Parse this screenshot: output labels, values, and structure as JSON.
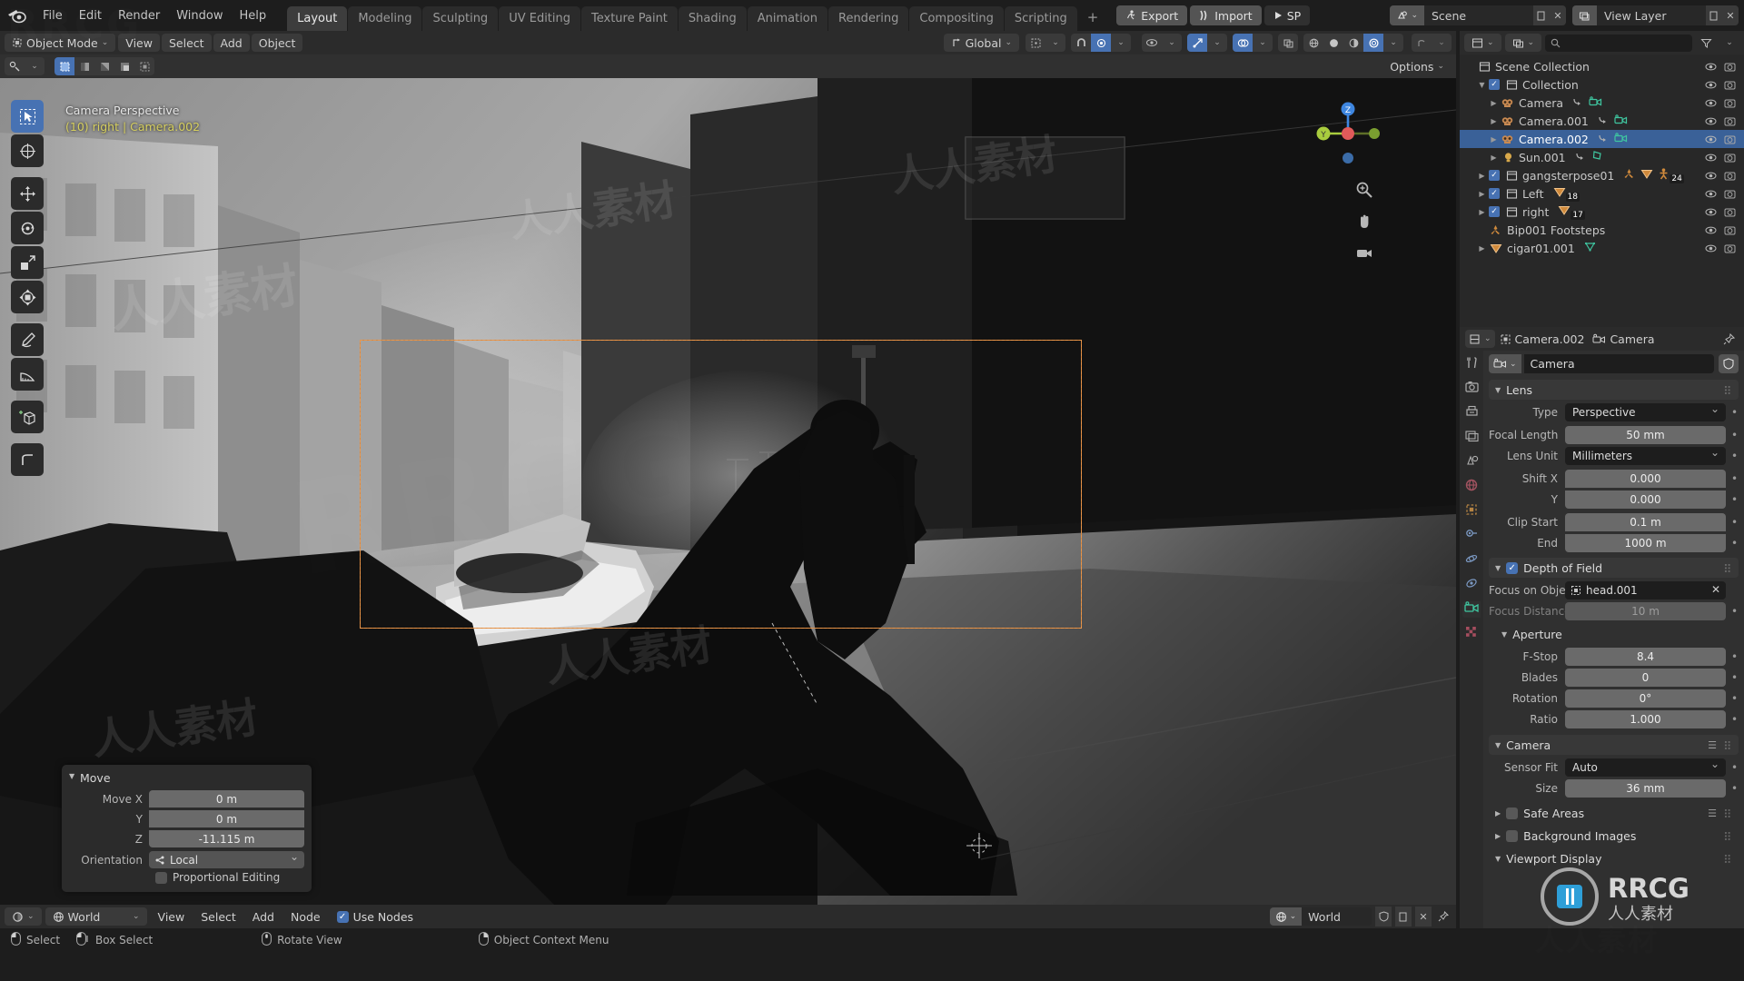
{
  "app": {
    "name": "Blender",
    "menus": [
      "File",
      "Edit",
      "Render",
      "Window",
      "Help"
    ],
    "workspace_tabs": [
      {
        "label": "Layout",
        "active": true
      },
      {
        "label": "Modeling",
        "active": false
      },
      {
        "label": "Sculpting",
        "active": false
      },
      {
        "label": "UV Editing",
        "active": false
      },
      {
        "label": "Texture Paint",
        "active": false
      },
      {
        "label": "Shading",
        "active": false
      },
      {
        "label": "Animation",
        "active": false
      },
      {
        "label": "Rendering",
        "active": false
      },
      {
        "label": "Compositing",
        "active": false
      },
      {
        "label": "Scripting",
        "active": false
      }
    ],
    "tab_add": "+",
    "addon_buttons": [
      {
        "label": "Export",
        "icon": "person-run-icon"
      },
      {
        "label": "Import",
        "icon": "import-arrow-icon"
      },
      {
        "label": "SP",
        "icon": "play-icon"
      }
    ],
    "scene_selector": {
      "icon": "scene-icon",
      "value": "Scene"
    },
    "viewlayer_selector": {
      "icon": "viewlayer-icon",
      "value": "View Layer"
    }
  },
  "viewport_header": {
    "mode": "Object Mode",
    "menus": [
      "View",
      "Select",
      "Add",
      "Object"
    ],
    "transform_orientation": "Global",
    "options_label": "Options",
    "snap_icon": "magnet-icon",
    "proportional_icon": "proportional-edit-icon",
    "shading_modes": [
      "wireframe",
      "solid",
      "material-preview",
      "rendered"
    ],
    "active_shading": "rendered"
  },
  "viewport": {
    "overlay_view": "Camera Perspective",
    "overlay_object": "(10) right | Camera.002",
    "tools": [
      {
        "name": "tweak-select-box-tool",
        "active": true
      },
      {
        "name": "cursor-tool",
        "active": false
      },
      {
        "name": "move-tool",
        "active": false
      },
      {
        "name": "rotate-tool",
        "active": false
      },
      {
        "name": "scale-tool",
        "active": false
      },
      {
        "name": "transform-tool",
        "active": false
      },
      {
        "name": "annotate-tool",
        "active": false
      },
      {
        "name": "measure-tool",
        "active": false
      },
      {
        "name": "add-cube-tool",
        "active": false
      },
      {
        "name": "extrude-tool",
        "active": false
      }
    ],
    "gizmo_axes": [
      "X",
      "Y",
      "Z"
    ],
    "nav_buttons": [
      "zoom-icon",
      "pan-hand-icon",
      "camera-view-icon"
    ]
  },
  "operator_panel": {
    "title": "Move",
    "rows": [
      {
        "label": "Move X",
        "value": "0 m"
      },
      {
        "label": "Y",
        "value": "0 m"
      },
      {
        "label": "Z",
        "value": "-11.115 m"
      }
    ],
    "orientation_label": "Orientation",
    "orientation_value": "Local",
    "proportional_label": "Proportional Editing",
    "proportional_checked": false
  },
  "shader_editor_header": {
    "editor_icon": "shader-editor-icon",
    "shader_type": "World",
    "menus": [
      "View",
      "Select",
      "Add",
      "Node"
    ],
    "use_nodes_label": "Use Nodes",
    "use_nodes_checked": true,
    "world_datablock": "World"
  },
  "status_bar": {
    "items": [
      {
        "icon": "mouse-left-icon",
        "label": "Select"
      },
      {
        "icon": "mouse-left-drag-icon",
        "label": "Box Select"
      },
      {
        "icon": "mouse-middle-icon",
        "label": "Rotate View"
      },
      {
        "icon": "mouse-right-icon",
        "label": "Object Context Menu"
      }
    ]
  },
  "outliner": {
    "display_mode": "View Layer",
    "filter_icon": "filter-icon",
    "search_icon": "search-icon",
    "root": "Scene Collection",
    "rows": [
      {
        "indent": 0,
        "label": "Scene Collection",
        "icon": "collection-icon",
        "disclosure": "",
        "checkbox": null,
        "selected": false,
        "badges": []
      },
      {
        "indent": 1,
        "label": "Collection",
        "icon": "collection-icon",
        "disclosure": "down",
        "checkbox": true,
        "selected": false,
        "badges": []
      },
      {
        "indent": 2,
        "label": "Camera",
        "icon": "camera-object-icon",
        "disclosure": "right",
        "checkbox": null,
        "selected": false,
        "badges": [
          "camera-data-icon"
        ]
      },
      {
        "indent": 2,
        "label": "Camera.001",
        "icon": "camera-object-icon",
        "disclosure": "right",
        "checkbox": null,
        "selected": false,
        "badges": [
          "camera-data-icon"
        ]
      },
      {
        "indent": 2,
        "label": "Camera.002",
        "icon": "camera-object-icon",
        "disclosure": "right",
        "checkbox": null,
        "selected": true,
        "badges": [
          "camera-data-icon"
        ]
      },
      {
        "indent": 2,
        "label": "Sun.001",
        "icon": "light-object-icon",
        "disclosure": "right",
        "checkbox": null,
        "selected": false,
        "badges": [
          "light-data-icon"
        ]
      },
      {
        "indent": 1,
        "label": "gangsterpose01",
        "icon": "collection-icon",
        "disclosure": "right",
        "checkbox": true,
        "selected": false,
        "badges": [
          "armature-icon",
          "mesh-icon",
          "pose-icon"
        ],
        "badge_count": "24"
      },
      {
        "indent": 1,
        "label": "Left",
        "icon": "collection-icon",
        "disclosure": "right",
        "checkbox": true,
        "selected": false,
        "badges": [
          "mesh-icon"
        ],
        "badge_count": "18"
      },
      {
        "indent": 1,
        "label": "right",
        "icon": "collection-icon",
        "disclosure": "right",
        "checkbox": true,
        "selected": false,
        "badges": [
          "mesh-icon"
        ],
        "badge_count": "17"
      },
      {
        "indent": 1,
        "label": "Bip001 Footsteps",
        "icon": "armature-icon",
        "disclosure": "",
        "checkbox": null,
        "selected": false,
        "badges": []
      },
      {
        "indent": 1,
        "label": "cigar01.001",
        "icon": "mesh-icon",
        "disclosure": "right",
        "checkbox": null,
        "selected": false,
        "badges": [
          "mesh-data-icon"
        ]
      }
    ]
  },
  "properties": {
    "breadcrumb": [
      {
        "label": "Camera.002",
        "icon": "object-icon"
      },
      {
        "label": "Camera",
        "icon": "camera-data-icon"
      }
    ],
    "pin_icon": "pin-icon",
    "datablock_name": "Camera",
    "tabs": [
      {
        "name": "tool-tab",
        "icon": "wrench-screwdriver-icon",
        "active": false
      },
      {
        "name": "render-tab",
        "icon": "camera-back-icon",
        "active": false
      },
      {
        "name": "output-tab",
        "icon": "printer-icon",
        "active": false
      },
      {
        "name": "viewlayer-tab",
        "icon": "images-icon",
        "active": false
      },
      {
        "name": "scene-tab",
        "icon": "cone-sphere-icon",
        "active": false
      },
      {
        "name": "world-tab",
        "icon": "world-globe-icon",
        "active": false
      },
      {
        "name": "object-tab",
        "icon": "orange-square-icon",
        "active": false
      },
      {
        "name": "modifiers-tab",
        "icon": "wrench-icon",
        "active": false
      },
      {
        "name": "physics-tab",
        "icon": "physics-orbit-icon",
        "active": false
      },
      {
        "name": "constraints-tab",
        "icon": "constraint-icon",
        "active": false
      },
      {
        "name": "data-tab",
        "icon": "camera-data-icon",
        "active": true
      },
      {
        "name": "texture-tab",
        "icon": "checker-icon",
        "active": false
      }
    ],
    "panels": [
      {
        "id": "lens",
        "title": "Lens",
        "expanded": true,
        "rows": [
          {
            "label": "Type",
            "value": "Perspective",
            "kind": "select"
          },
          {
            "label": "Focal Length",
            "value": "50 mm",
            "kind": "value"
          },
          {
            "label": "Lens Unit",
            "value": "Millimeters",
            "kind": "select"
          },
          {
            "label": "Shift X",
            "value": "0.000",
            "kind": "value"
          },
          {
            "label": "Y",
            "value": "0.000",
            "kind": "value"
          },
          {
            "label": "Clip Start",
            "value": "0.1 m",
            "kind": "value"
          },
          {
            "label": "End",
            "value": "1000 m",
            "kind": "value"
          }
        ]
      },
      {
        "id": "depth_of_field",
        "title": "Depth of Field",
        "expanded": true,
        "checked": true,
        "rows": [
          {
            "label": "Focus on Object",
            "value": "head.001",
            "kind": "object"
          },
          {
            "label": "Focus Distance",
            "value": "10 m",
            "kind": "value",
            "disabled": true
          }
        ],
        "subpanel": {
          "title": "Aperture",
          "rows": [
            {
              "label": "F-Stop",
              "value": "8.4",
              "kind": "value"
            },
            {
              "label": "Blades",
              "value": "0",
              "kind": "value"
            },
            {
              "label": "Rotation",
              "value": "0°",
              "kind": "value"
            },
            {
              "label": "Ratio",
              "value": "1.000",
              "kind": "value"
            }
          ]
        }
      },
      {
        "id": "camera",
        "title": "Camera",
        "expanded": true,
        "rows": [
          {
            "label": "Sensor Fit",
            "value": "Auto",
            "kind": "select"
          },
          {
            "label": "Size",
            "value": "36 mm",
            "kind": "value"
          }
        ]
      }
    ],
    "collapsed_panels": [
      {
        "title": "Safe Areas",
        "checked": false,
        "has_list": true
      },
      {
        "title": "Background Images",
        "checked": false,
        "has_list": false
      },
      {
        "title": "Viewport Display",
        "checked": null,
        "has_list": false,
        "expanded": true
      }
    ]
  },
  "watermarks": {
    "brand": "RRCG",
    "cn_text": "人人素材",
    "footer_brand": "RRCG",
    "footer_cn": "人人素材"
  },
  "colors": {
    "accent_blue": "#4772b3",
    "select_orange": "#e08a3c",
    "panel_bg": "#303030",
    "header_bg": "#2b2b2b",
    "editor_bg": "#282828",
    "axis_x": "#e05a5a",
    "axis_y": "#a9cc3e",
    "axis_z": "#3e86e0"
  }
}
